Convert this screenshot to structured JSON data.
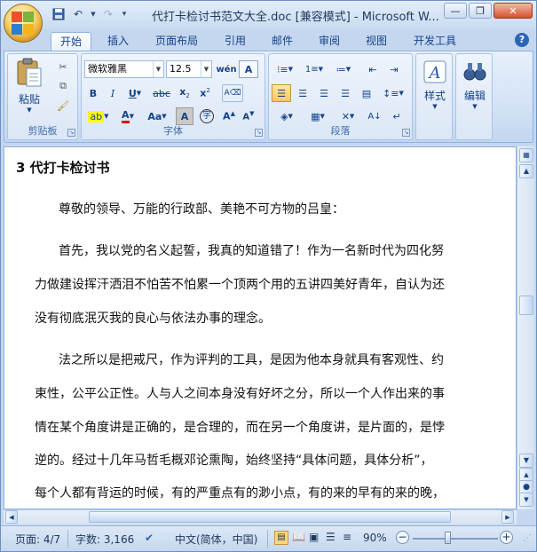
{
  "titlebar": {
    "title": "代打卡检讨书范文大全.doc [兼容模式] - Microsoft W...",
    "qat_icons": [
      "save-icon",
      "undo-icon",
      "redo-icon",
      "customize-icon"
    ]
  },
  "tabs": [
    {
      "label": "开始",
      "active": true
    },
    {
      "label": "插入"
    },
    {
      "label": "页面布局"
    },
    {
      "label": "引用"
    },
    {
      "label": "邮件"
    },
    {
      "label": "审阅"
    },
    {
      "label": "视图"
    },
    {
      "label": "开发工具"
    }
  ],
  "ribbon": {
    "clipboard": {
      "label": "剪贴板",
      "paste_label": "粘贴"
    },
    "font": {
      "label": "字体",
      "font_name": "微软雅黑",
      "font_size": "12.5"
    },
    "paragraph": {
      "label": "段落"
    },
    "styles": {
      "label": "样式"
    },
    "editing": {
      "label": "编辑"
    }
  },
  "document": {
    "heading": "3 代打卡检讨书",
    "lines": [
      "尊敬的领导、万能的行政部、美艳不可方物的吕皇：",
      "首先，我以党的名义起誓，我真的知道错了！作为一名新时代为四化努",
      "力做建设挥汗洒泪不怕苦不怕累一个顶两个用的五讲四美好青年，自认为还",
      "没有彻底泯灭我的良心与依法办事的理念。",
      "法之所以是把戒尺，作为评判的工具，是因为他本身就具有客观性、约",
      "束性，公平公正性。人与人之间本身没有好坏之分，所以一个人作出来的事",
      "情在某个角度讲是正确的，是合理的，而在另一个角度讲，是片面的，是悖",
      "逆的。经过十几年马哲毛概邓论熏陶，始终坚持“具体问题，具体分析”，",
      "每个人都有背运的时候，有的严重点有的渺小点，有的来的早有的来的晚，"
    ]
  },
  "statusbar": {
    "page": "页面: 4/7",
    "words": "字数: 3,166",
    "language": "中文(简体，中国)",
    "zoom": "90%"
  }
}
